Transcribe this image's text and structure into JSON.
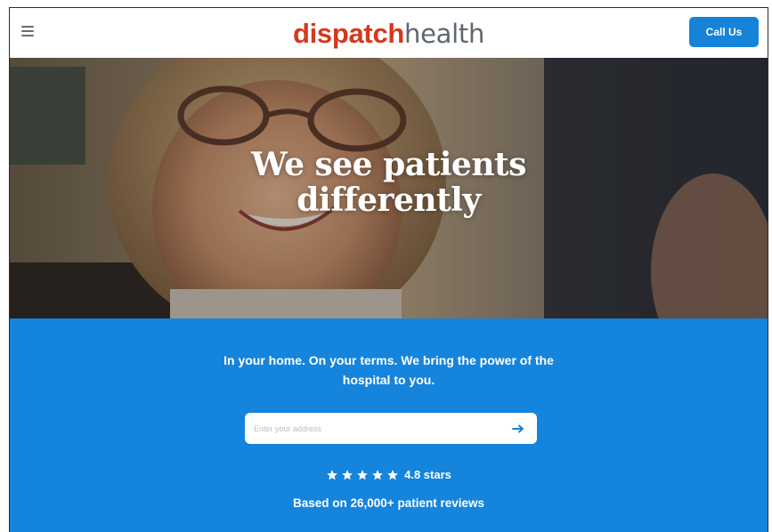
{
  "header": {
    "logo_part1": "dispatch",
    "logo_part2": "health",
    "call_label": "Call Us",
    "menu_icon": "hamburger-menu-icon"
  },
  "hero": {
    "title_line1": "We see patients",
    "title_line2": "differently"
  },
  "band": {
    "tagline_line1": "In your home. On your terms. We bring the power of the",
    "tagline_line2": "hospital to you.",
    "address_placeholder": "Enter your address",
    "submit_icon": "arrow-right-icon",
    "stars_filled": 5,
    "rating_text": "4.8 stars",
    "reviews_text": "Based on 26,000+ patient reviews"
  },
  "colors": {
    "brand_red": "#d4381e",
    "brand_gray": "#5f6770",
    "accent_blue": "#1584dc",
    "button_blue": "#1583d8"
  }
}
